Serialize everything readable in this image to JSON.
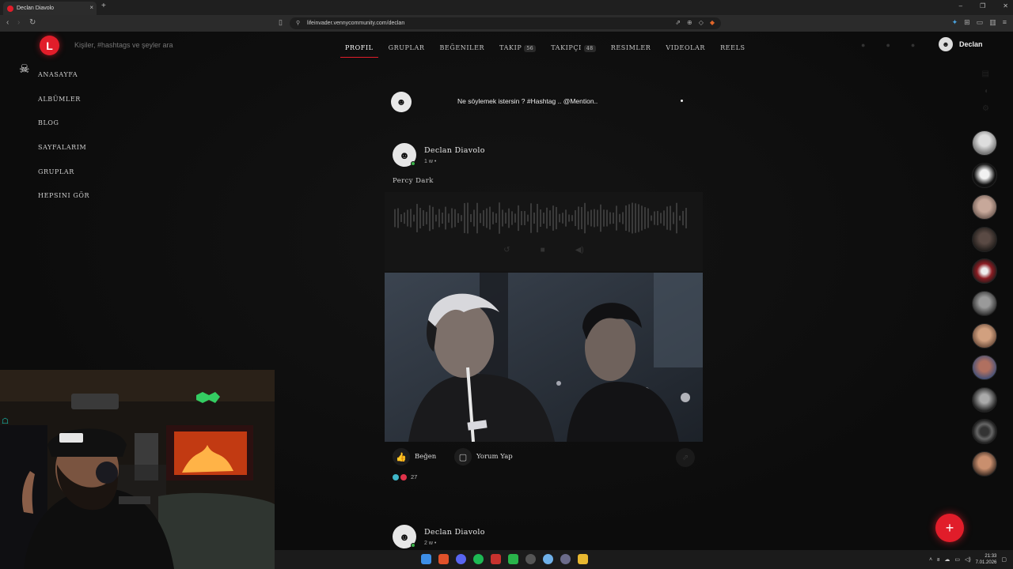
{
  "browser": {
    "tab_title": "Declan Diavolo",
    "tab_close": "×",
    "new_tab": "+",
    "url": "lifeinvader.vennycommunity.com/declan",
    "controls": [
      "–",
      "❐",
      "✕"
    ]
  },
  "header": {
    "logo_letter": "L",
    "search_placeholder": "Kişiler, #hashtags ve şeyler ara",
    "nav": [
      {
        "label": "Profil",
        "active": true
      },
      {
        "label": "Gruplar"
      },
      {
        "label": "Beğeniler"
      },
      {
        "label": "Takip",
        "count": "56"
      },
      {
        "label": "Takipçi",
        "count": "48"
      },
      {
        "label": "Resimler"
      },
      {
        "label": "Videolar"
      },
      {
        "label": "Reels"
      }
    ],
    "user_name": "Declan"
  },
  "sidebar": {
    "items": [
      "Anasayfa",
      "Albümler",
      "Blog",
      "Sayfalarım",
      "Gruplar",
      "Hepsini gör"
    ]
  },
  "composer": {
    "placeholder": "Ne söylemek istersin ? #Hashtag .. @Mention.."
  },
  "posts": [
    {
      "author": "Declan Diavolo",
      "time": "1 w •",
      "text": "Percy Dark",
      "actions": {
        "like": "Beğen",
        "comment": "Yorum Yap"
      },
      "reaction_count": "27"
    },
    {
      "author": "Declan Diavolo",
      "time": "2 w •"
    }
  ],
  "fab_label": "+",
  "taskbar": {
    "time": "21:33",
    "date": "7.01.2026"
  },
  "colors": {
    "accent": "#e11d2a",
    "background": "#0d0d0d",
    "online": "#3cb44a"
  }
}
